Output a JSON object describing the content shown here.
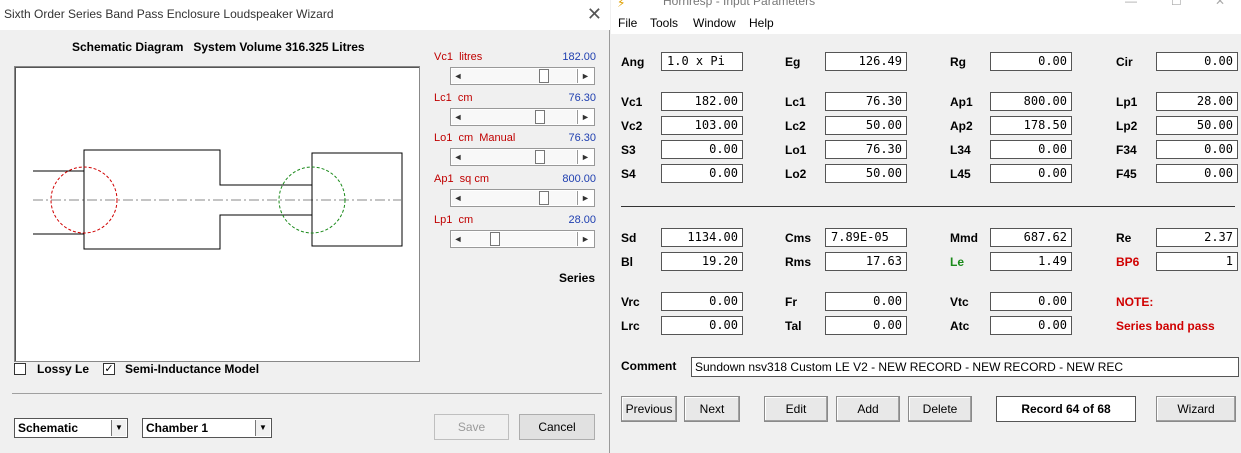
{
  "wizard": {
    "title": "Sixth Order Series Band Pass Enclosure Loudspeaker Wizard",
    "close_glyph": "✕",
    "schematic_caption": "Schematic Diagram   System Volume 316.325 Litres",
    "sliders": [
      {
        "label": "Vc1  litres",
        "value": "182.00",
        "position": 0.72
      },
      {
        "label": "Lc1  cm",
        "value": "76.30",
        "position": 0.69
      },
      {
        "label": "Lo1  cm  Manual",
        "value": "76.30",
        "position": 0.69
      },
      {
        "label": "Ap1  sq cm",
        "value": "800.00",
        "position": 0.72
      },
      {
        "label": "Lp1  cm",
        "value": "28.00",
        "position": 0.26
      }
    ],
    "series_label": "Series",
    "lossy_le": {
      "label": "Lossy Le",
      "checked": false,
      "check_glyph": ""
    },
    "semi_inductance": {
      "label": "Semi-Inductance Model",
      "checked": true,
      "check_glyph": "✓"
    },
    "view_select": "Schematic",
    "chamber_select": "Chamber 1",
    "save_label": "Save",
    "cancel_label": "Cancel",
    "dropdown_glyph": "▼",
    "arrow_left": "◄",
    "arrow_right": "►"
  },
  "horn": {
    "title": "Hornresp - Input Parameters",
    "menu": [
      "File",
      "Tools",
      "Window",
      "Help"
    ],
    "params_top": [
      [
        {
          "label": "Ang",
          "value": "1.0 x Pi",
          "align": "left"
        },
        {
          "label": "Eg",
          "value": "126.49"
        },
        {
          "label": "Rg",
          "value": "0.00"
        },
        {
          "label": "Cir",
          "value": "0.00"
        }
      ],
      [
        {
          "label": "Vc1",
          "value": "182.00"
        },
        {
          "label": "Lc1",
          "value": "76.30"
        },
        {
          "label": "Ap1",
          "value": "800.00"
        },
        {
          "label": "Lp1",
          "value": "28.00"
        }
      ],
      [
        {
          "label": "Vc2",
          "value": "103.00"
        },
        {
          "label": "Lc2",
          "value": "50.00"
        },
        {
          "label": "Ap2",
          "value": "178.50"
        },
        {
          "label": "Lp2",
          "value": "50.00"
        }
      ],
      [
        {
          "label": "S3",
          "value": "0.00"
        },
        {
          "label": "Lo1",
          "value": "76.30"
        },
        {
          "label": "L34",
          "value": "0.00"
        },
        {
          "label": "F34",
          "value": "0.00"
        }
      ],
      [
        {
          "label": "S4",
          "value": "0.00"
        },
        {
          "label": "Lo2",
          "value": "50.00"
        },
        {
          "label": "L45",
          "value": "0.00"
        },
        {
          "label": "F45",
          "value": "0.00"
        }
      ]
    ],
    "params_driver": [
      [
        {
          "label": "Sd",
          "value": "1134.00"
        },
        {
          "label": "Cms",
          "value": "7.89E-05",
          "align": "left"
        },
        {
          "label": "Mmd",
          "value": "687.62"
        },
        {
          "label": "Re",
          "value": "2.37"
        }
      ],
      [
        {
          "label": "Bl",
          "value": "19.20"
        },
        {
          "label": "Rms",
          "value": "17.63"
        },
        {
          "label": "Le",
          "value": "1.49",
          "color": "green"
        },
        {
          "label": "BP6",
          "value": "1",
          "color": "red"
        }
      ]
    ],
    "params_extra": [
      [
        {
          "label": "Vrc",
          "value": "0.00"
        },
        {
          "label": "Fr",
          "value": "0.00"
        },
        {
          "label": "Vtc",
          "value": "0.00"
        }
      ],
      [
        {
          "label": "Lrc",
          "value": "0.00"
        },
        {
          "label": "Tal",
          "value": "0.00"
        },
        {
          "label": "Atc",
          "value": "0.00"
        }
      ]
    ],
    "note_label": "NOTE:",
    "note_text": "Series band pass",
    "comment_label": "Comment",
    "comment_value": "Sundown nsv318 Custom LE V2 - NEW RECORD - NEW RECORD - NEW REC",
    "buttons": {
      "previous": "Previous",
      "next": "Next",
      "edit": "Edit",
      "add": "Add",
      "delete": "Delete",
      "wizard": "Wizard"
    },
    "record_status": "Record 64 of 68"
  },
  "colors": {
    "label_red": "#c00000",
    "value_blue": "#1f3fb0",
    "le_green": "#1a8a1a",
    "note_red": "#d00000",
    "chamber_circle_red": "#d00000",
    "chamber_circle_green": "#1a8a1a"
  }
}
